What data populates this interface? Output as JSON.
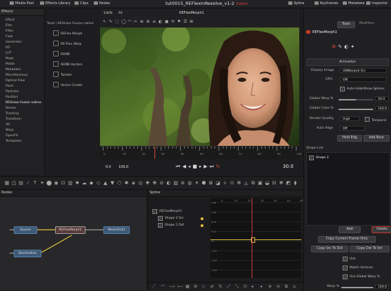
{
  "topbar": {
    "left_items": [
      "Media Pool",
      "Effects Library",
      "Clips",
      "Nodes"
    ],
    "title": "tut0015_REFlexInResolve_v1-2",
    "edited": "Edited",
    "right_items": [
      "Spline",
      "Keyframes",
      "Metadata",
      "Inspector"
    ]
  },
  "effects": {
    "header": "Effects",
    "tree": [
      "Effect",
      "Film",
      "Filter",
      "Flow",
      "Generator",
      "I/O",
      "LUT",
      "Mask",
      "Matte",
      "Metadata",
      "Miscellaneous",
      "Optical Flow",
      "Paint",
      "Particles",
      "Position",
      "REVision Fusion native",
      "Stereo",
      "Tracking",
      "Transform",
      "VR",
      "Warp",
      "OpenFX",
      "Templates"
    ],
    "selected_index": 15,
    "path": "Tools \\ REVision Fusion native",
    "tools": [
      "REFlex Morph",
      "RE:Flex Warp",
      "REMB",
      "REMB Vectors",
      "Twixtor",
      "Vector Create"
    ]
  },
  "viewer": {
    "zoom": "130%",
    "dropdown": "Fit",
    "name": "REFlexMorph1",
    "range_start": "0.0",
    "range_end": "106.0",
    "current_frame": "30.0",
    "ruler_labels": [
      "0",
      "10",
      "20",
      "30",
      "40",
      "50",
      "60",
      "70",
      "80",
      "90",
      "100"
    ]
  },
  "inspector": {
    "tabs": [
      "Tools",
      "Modifiers"
    ],
    "node_name": "REFlexMorph1",
    "activation": "Activation",
    "display_image_label": "Display Image",
    "display_image_value": "UNWarped Src",
    "gpu_label": "GPU",
    "gpu_value": "ON",
    "auto_hide": "Auto Hide/Show Splines",
    "global_warp_label": "Global Warp %",
    "global_warp_value": "50.0",
    "global_warp_fraction": 0.5,
    "global_color_label": "Global Color %",
    "global_color_value": "100.0",
    "global_color_fraction": 1.0,
    "render_quality_label": "Render Quality",
    "render_quality_value": "High",
    "temporal": "Temporal",
    "auto_align_label": "Auto Align",
    "auto_align_value": "Off",
    "hold_edg": "Hold Edg",
    "add_bour": "Add Bour",
    "shape_list_label": "Shape List",
    "shape_item": "Shape 2",
    "add": "Add",
    "delete": "Delete",
    "copy_current_frame": "Copy Current Frame Only",
    "copy_src_to_dst": "Copy Src To Dst",
    "copy_dst_to_src": "Copy Dst To Src",
    "use": "Use",
    "match_vertices": "Match Vertices",
    "use_global_warp": "Use Global Warp %",
    "warp_label": "Warp %",
    "warp_value": "100.0",
    "colors": {
      "accent": "#c8372c",
      "check": "#e0e0e0"
    }
  },
  "nodes": {
    "header": "Nodes",
    "items": [
      "Source",
      "REFlexMorph1",
      "MediaOut1",
      "Destination"
    ]
  },
  "spline": {
    "header": "Spline",
    "tree_root": "REFlexMorph1",
    "children": [
      "Shape 2 Src",
      "Shape 2 Dst"
    ],
    "y_labels": [
      "0.8",
      "0.6",
      "0.4",
      "0.2",
      "0",
      "-0.2",
      "-0.4",
      "-0.6"
    ],
    "x_labels": [
      "0",
      "10",
      "20",
      "30",
      "40",
      "50",
      "60"
    ],
    "colors": {
      "curve": "#e2c23a",
      "playhead": "#d63a3a"
    }
  }
}
